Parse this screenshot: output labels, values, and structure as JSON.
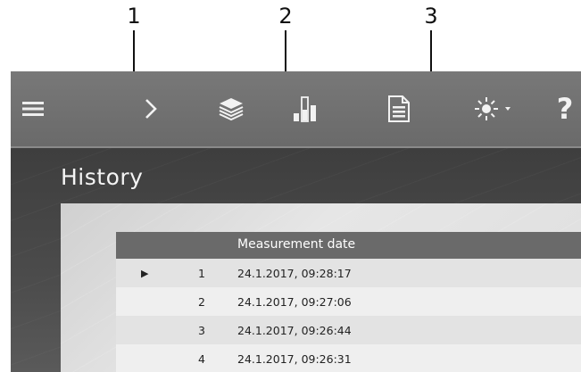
{
  "callouts": [
    "1",
    "2",
    "3"
  ],
  "toolbar": {
    "icons": [
      "menu-icon",
      "chevron-right-icon",
      "layers-icon",
      "bar-chart-icon",
      "document-icon",
      "brightness-icon",
      "help-icon"
    ],
    "help_label": "?"
  },
  "page": {
    "title": "History"
  },
  "table": {
    "header": "Measurement date",
    "rows": [
      {
        "index": "1",
        "date": "24.1.2017, 09:28:17",
        "selected": true
      },
      {
        "index": "2",
        "date": "24.1.2017, 09:27:06",
        "selected": false
      },
      {
        "index": "3",
        "date": "24.1.2017, 09:26:44",
        "selected": false
      },
      {
        "index": "4",
        "date": "24.1.2017, 09:26:31",
        "selected": false
      }
    ]
  },
  "colors": {
    "toolbar": "#737373",
    "header_row": "#6a6a6a",
    "title_text": "#f4f4f4"
  }
}
